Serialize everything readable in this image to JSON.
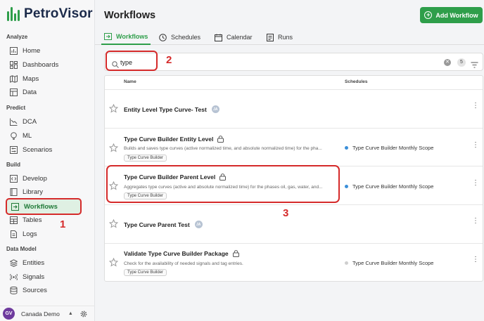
{
  "app": {
    "name": "PetroVisor"
  },
  "sidebar": {
    "sections": [
      {
        "label": "Analyze"
      },
      {
        "label": "Predict"
      },
      {
        "label": "Build"
      },
      {
        "label": "Data Model"
      }
    ],
    "items": [
      {
        "label": "Home",
        "icon": "chart-icon"
      },
      {
        "label": "Dashboards",
        "icon": "dashboard-icon"
      },
      {
        "label": "Maps",
        "icon": "map-icon"
      },
      {
        "label": "Data",
        "icon": "table-icon"
      },
      {
        "label": "DCA",
        "icon": "line-chart-icon"
      },
      {
        "label": "ML",
        "icon": "bulb-icon"
      },
      {
        "label": "Scenarios",
        "icon": "sliders-icon"
      },
      {
        "label": "Develop",
        "icon": "code-icon"
      },
      {
        "label": "Library",
        "icon": "book-icon"
      },
      {
        "label": "Workflows",
        "icon": "workflow-icon",
        "active": true
      },
      {
        "label": "Tables",
        "icon": "table-icon"
      },
      {
        "label": "Logs",
        "icon": "document-icon"
      },
      {
        "label": "Entities",
        "icon": "layers-icon"
      },
      {
        "label": "Signals",
        "icon": "signal-icon"
      },
      {
        "label": "Sources",
        "icon": "database-icon"
      }
    ],
    "footer": {
      "avatar_initials": "GV",
      "org": "Canada Demo"
    }
  },
  "header": {
    "title": "Workflows",
    "add_button": "Add Workflow"
  },
  "tabs": [
    {
      "label": "Workflows",
      "active": true
    },
    {
      "label": "Schedules"
    },
    {
      "label": "Calendar"
    },
    {
      "label": "Runs"
    }
  ],
  "search": {
    "value": "type",
    "count": "5"
  },
  "table": {
    "columns": [
      "Name",
      "Schedules"
    ],
    "rows": [
      {
        "name": "Entity Level Type Curve- Test",
        "avatar": "JA",
        "desc": "",
        "tag": "",
        "schedule": "",
        "locked": false
      },
      {
        "name": "Type Curve Builder Entity Level",
        "locked": true,
        "desc": "Builds and saves type curves (active normalized time, and absolute normalized time) for the pha...",
        "tag": "Type Curve Builder",
        "schedule": "Type Curve Builder Monthly Scope",
        "schedule_active": true
      },
      {
        "name": "Type Curve Builder Parent Level",
        "locked": true,
        "desc": "Aggregates type curves (active and absolute normalized time) for the phases oil, gas, water, and...",
        "tag": "Type Curve Builder",
        "schedule": "Type Curve Builder Monthly Scope",
        "schedule_active": true
      },
      {
        "name": "Type Curve Parent Test",
        "avatar": "JA",
        "desc": "",
        "tag": "",
        "schedule": "",
        "locked": false
      },
      {
        "name": "Validate Type Curve Builder Package",
        "locked": true,
        "desc": "Check for the availability of needed signals and tag entries.",
        "tag": "Type Curve Builder",
        "schedule": "Type Curve Builder Monthly Scope",
        "schedule_active": false
      }
    ]
  },
  "annotations": [
    "1",
    "2",
    "3"
  ],
  "colors": {
    "brand": "#2e9e4a",
    "annotation": "#d52a2a",
    "schedule_active": "#3b8fd9",
    "schedule_inactive": "#cfcfcf"
  }
}
